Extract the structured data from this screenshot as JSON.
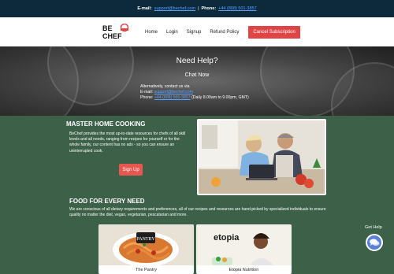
{
  "topbar": {
    "email_label": "E-mail:",
    "email": "support@bechef.com",
    "separator": "|",
    "phone_label": "Phone:",
    "phone": "+44 (808) 501-3857"
  },
  "nav": {
    "logo_text": "BE CHEF",
    "links": [
      "Home",
      "Login",
      "Signup",
      "Refund Policy"
    ],
    "cta": "Cancel Subscription"
  },
  "hero": {
    "title": "Need Help?",
    "subtitle": "Chat Now",
    "alt_contact": "Alternatively, contact us via",
    "email_label": "E-mail:",
    "email": "support@bechef.com",
    "phone_label": "Phone:",
    "phone": "+44 (808) 501-3857",
    "hours": "(Daily 8.00am to 9.00pm, GMT)"
  },
  "section_cooking": {
    "title": "MASTER HOME COOKING",
    "text": "BeChef provides the most up-to-date resources for chefs of all skill levels and all needs, ranging from recipes for yourself or for the whole family, our content has no ads - so you can ensure an uninterrupted cook.",
    "button": "Sign Up"
  },
  "section_needs": {
    "title": "FOOD FOR EVERY NEED",
    "text": "We are conscious of all dietary requirements and preferences, all of our recipes and resources are hand-picked by specialized individuals to ensure quality no matter the diet, vegan, vegetarian, pescatarian and more.",
    "cards": [
      {
        "label": "The Pantry",
        "badge": "PANTRY"
      },
      {
        "label": "Etopia Nutrition",
        "badge": "etopia"
      }
    ]
  },
  "help": {
    "label": "Get Help"
  },
  "colors": {
    "topbar_bg": "#0d2a3d",
    "page_bg": "#3d6048",
    "accent_red": "#e04545",
    "link_blue": "#5aa0ff",
    "help_blue": "#5a7fd6"
  }
}
